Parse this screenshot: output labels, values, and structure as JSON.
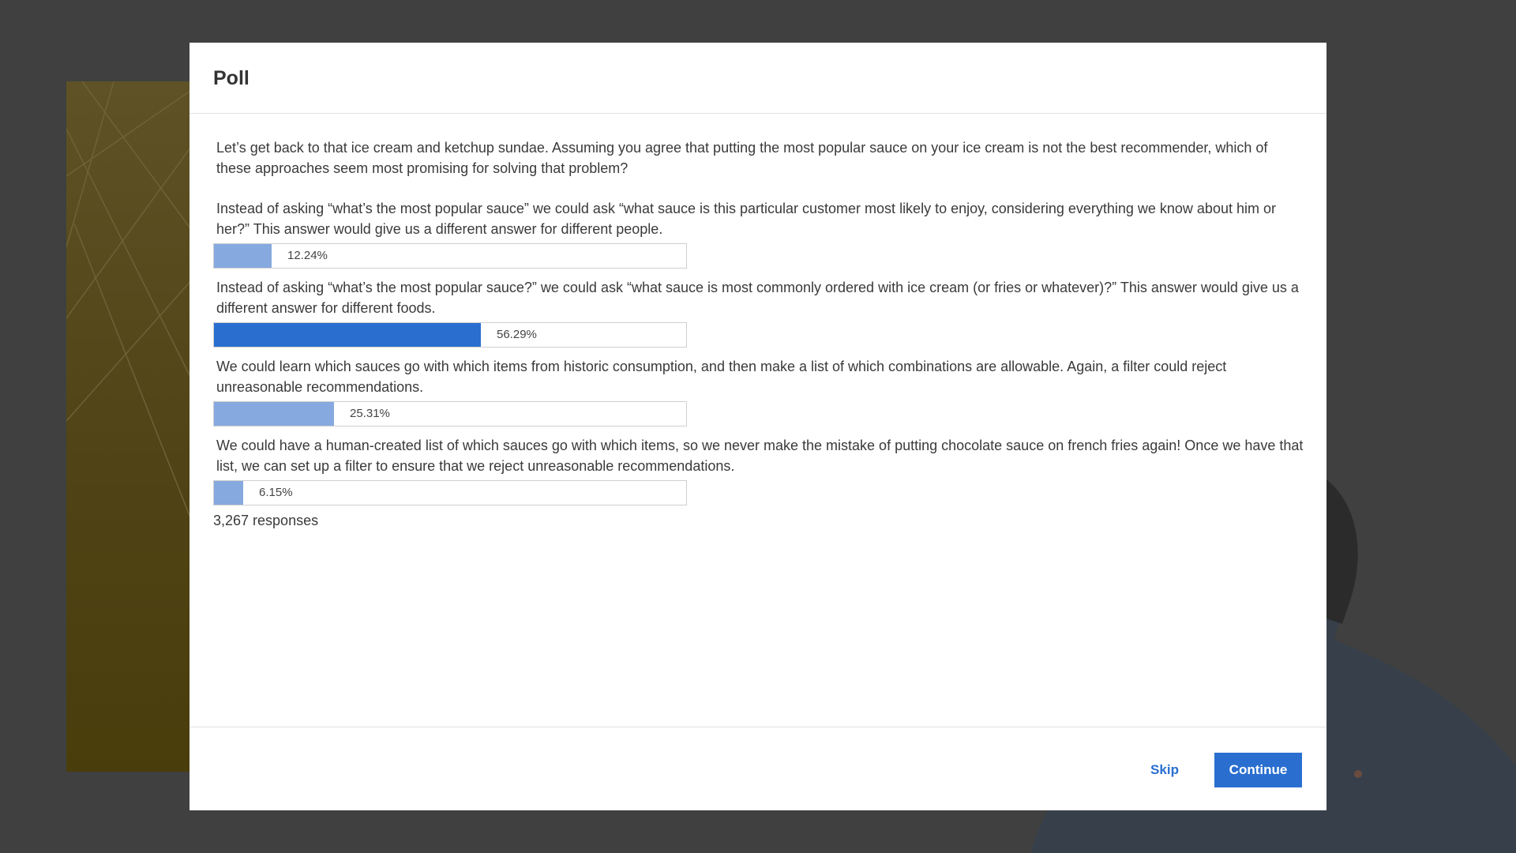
{
  "poll": {
    "title": "Poll",
    "question": "Let’s get back to that ice cream and ketchup sundae.  Assuming you agree that putting the most popular sauce on your ice cream is not the best recommender, which of these approaches seem most promising for solving that problem?",
    "options": [
      {
        "text": "Instead of asking “what’s the most popular sauce” we could ask “what sauce is this particular customer most likely to enjoy, considering everything we know about him or her?”  This answer would give us a different answer for different people.",
        "percent_label": "12.24%",
        "percent": 12.24
      },
      {
        "text": "Instead of asking “what’s the most popular sauce?” we could ask “what sauce is most commonly ordered with ice cream (or fries or whatever)?”  This answer would give us a different answer for different foods.",
        "percent_label": "56.29%",
        "percent": 56.29,
        "top_choice": true
      },
      {
        "text": "We could learn which sauces go with which items from historic consumption, and then make a list of which combinations are allowable.  Again, a filter could reject unreasonable recommendations.",
        "percent_label": "25.31%",
        "percent": 25.31
      },
      {
        "text": "We could have a human-created list of which sauces go with which items, so we never make the mistake of putting chocolate sauce on french fries again!  Once we have that list, we can set up a filter to ensure that we reject unreasonable recommendations.",
        "percent_label": "6.15%",
        "percent": 6.15
      }
    ],
    "responses": "3,267 responses"
  },
  "footer": {
    "skip_label": "Skip",
    "continue_label": "Continue"
  },
  "colors": {
    "accent": "#2a6fd0",
    "bar_fill": "#86a9e0",
    "bar_fill_top": "#2a6fd0",
    "overlay": "#404040"
  }
}
